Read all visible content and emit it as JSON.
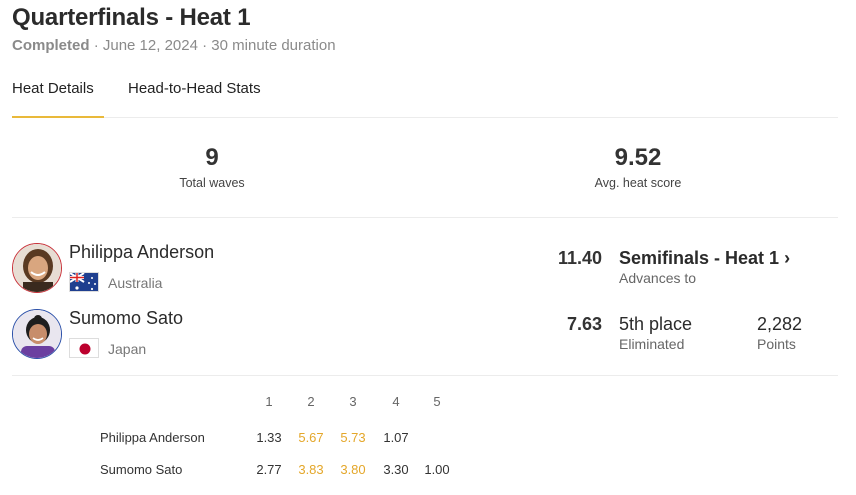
{
  "heat": {
    "title": "Quarterfinals - Heat 1",
    "status": "Completed",
    "date": "June 12, 2024",
    "duration": "30 minute duration",
    "separator": "·"
  },
  "tabs": [
    {
      "label": "Heat Details",
      "active": true
    },
    {
      "label": "Head-to-Head Stats",
      "active": false
    }
  ],
  "stats": {
    "total_waves": {
      "value": "9",
      "label": "Total waves"
    },
    "avg_heat_score": {
      "value": "9.52",
      "label": "Avg. heat score"
    }
  },
  "athletes": [
    {
      "name": "Philippa Anderson",
      "country": "Australia",
      "flag": "australia-flag",
      "avatar_border": "#c8323a",
      "score": "11.40",
      "result": "Semifinals - Heat 1",
      "result_sub": "Advances to",
      "chevron": "›"
    },
    {
      "name": "Sumomo Sato",
      "country": "Japan",
      "flag": "japan-flag",
      "avatar_border": "#2a4fa8",
      "score": "7.63",
      "result": "5th place",
      "result_sub": "Eliminated",
      "points": "2,282",
      "points_sub": "Points"
    }
  ],
  "wave_table": {
    "headers": [
      "1",
      "2",
      "3",
      "4",
      "5"
    ],
    "rows": [
      {
        "name": "Philippa Anderson",
        "waves": [
          "1.33",
          "5.67",
          "5.73",
          "1.07",
          ""
        ],
        "counting": [
          false,
          true,
          true,
          false,
          false
        ]
      },
      {
        "name": "Sumomo Sato",
        "waves": [
          "2.77",
          "3.83",
          "3.80",
          "3.30",
          "1.00"
        ],
        "counting": [
          false,
          true,
          true,
          false,
          false
        ]
      }
    ]
  },
  "colors": {
    "accent": "#e9b93a",
    "counting_wave": "#e4a72a"
  }
}
